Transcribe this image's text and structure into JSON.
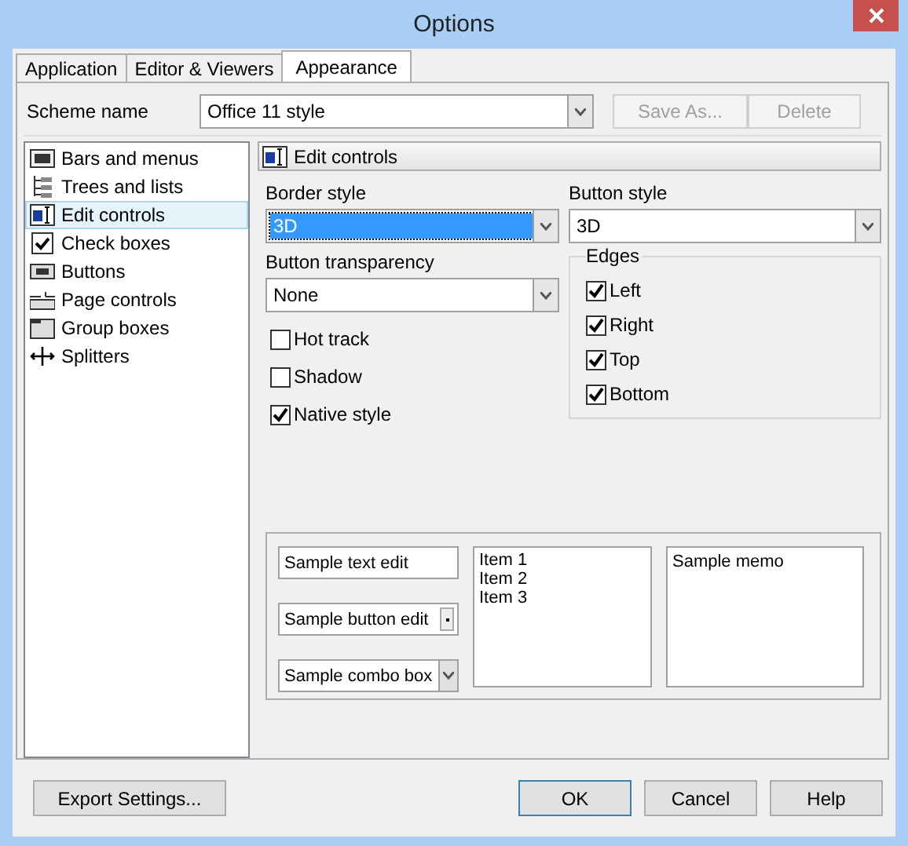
{
  "window": {
    "title": "Options"
  },
  "tabs": [
    {
      "label": "Application",
      "selected": false
    },
    {
      "label": "Editor & Viewers",
      "selected": false
    },
    {
      "label": "Appearance",
      "selected": true
    }
  ],
  "scheme": {
    "label": "Scheme name",
    "value": "Office 11 style",
    "buttons": [
      {
        "label": "Save As...",
        "disabled": true
      },
      {
        "label": "Delete",
        "disabled": true
      }
    ]
  },
  "categories": [
    {
      "label": "Bars and menus",
      "kind": "bars",
      "selected": false
    },
    {
      "label": "Trees and lists",
      "kind": "tree",
      "selected": false
    },
    {
      "label": "Edit controls",
      "kind": "edit",
      "selected": true
    },
    {
      "label": "Check boxes",
      "kind": "check",
      "selected": false
    },
    {
      "label": "Buttons",
      "kind": "button",
      "selected": false
    },
    {
      "label": "Page controls",
      "kind": "page",
      "selected": false
    },
    {
      "label": "Group boxes",
      "kind": "group",
      "selected": false
    },
    {
      "label": "Splitters",
      "kind": "splitter",
      "selected": false
    }
  ],
  "panel": {
    "title": "Edit controls",
    "border_style": {
      "label": "Border style",
      "value": "3D",
      "focused": true
    },
    "button_style": {
      "label": "Button style",
      "value": "3D",
      "focused": false
    },
    "button_transparency": {
      "label": "Button transparency",
      "value": "None",
      "focused": false
    },
    "options": [
      {
        "label": "Hot track",
        "checked": false
      },
      {
        "label": "Shadow",
        "checked": false
      },
      {
        "label": "Native style",
        "checked": true
      }
    ],
    "edges": {
      "title": "Edges",
      "items": [
        {
          "label": "Left",
          "checked": true
        },
        {
          "label": "Right",
          "checked": true
        },
        {
          "label": "Top",
          "checked": true
        },
        {
          "label": "Bottom",
          "checked": true
        }
      ]
    },
    "samples": {
      "text_edit": "Sample text edit",
      "button_edit": "Sample button edit",
      "combo_box": "Sample combo box",
      "list_items": [
        "Item 1",
        "Item 2",
        "Item 3"
      ],
      "memo": "Sample memo"
    }
  },
  "footer": {
    "export": "Export Settings...",
    "buttons": [
      {
        "label": "OK",
        "default": true
      },
      {
        "label": "Cancel",
        "default": false
      },
      {
        "label": "Help",
        "default": false
      }
    ]
  }
}
